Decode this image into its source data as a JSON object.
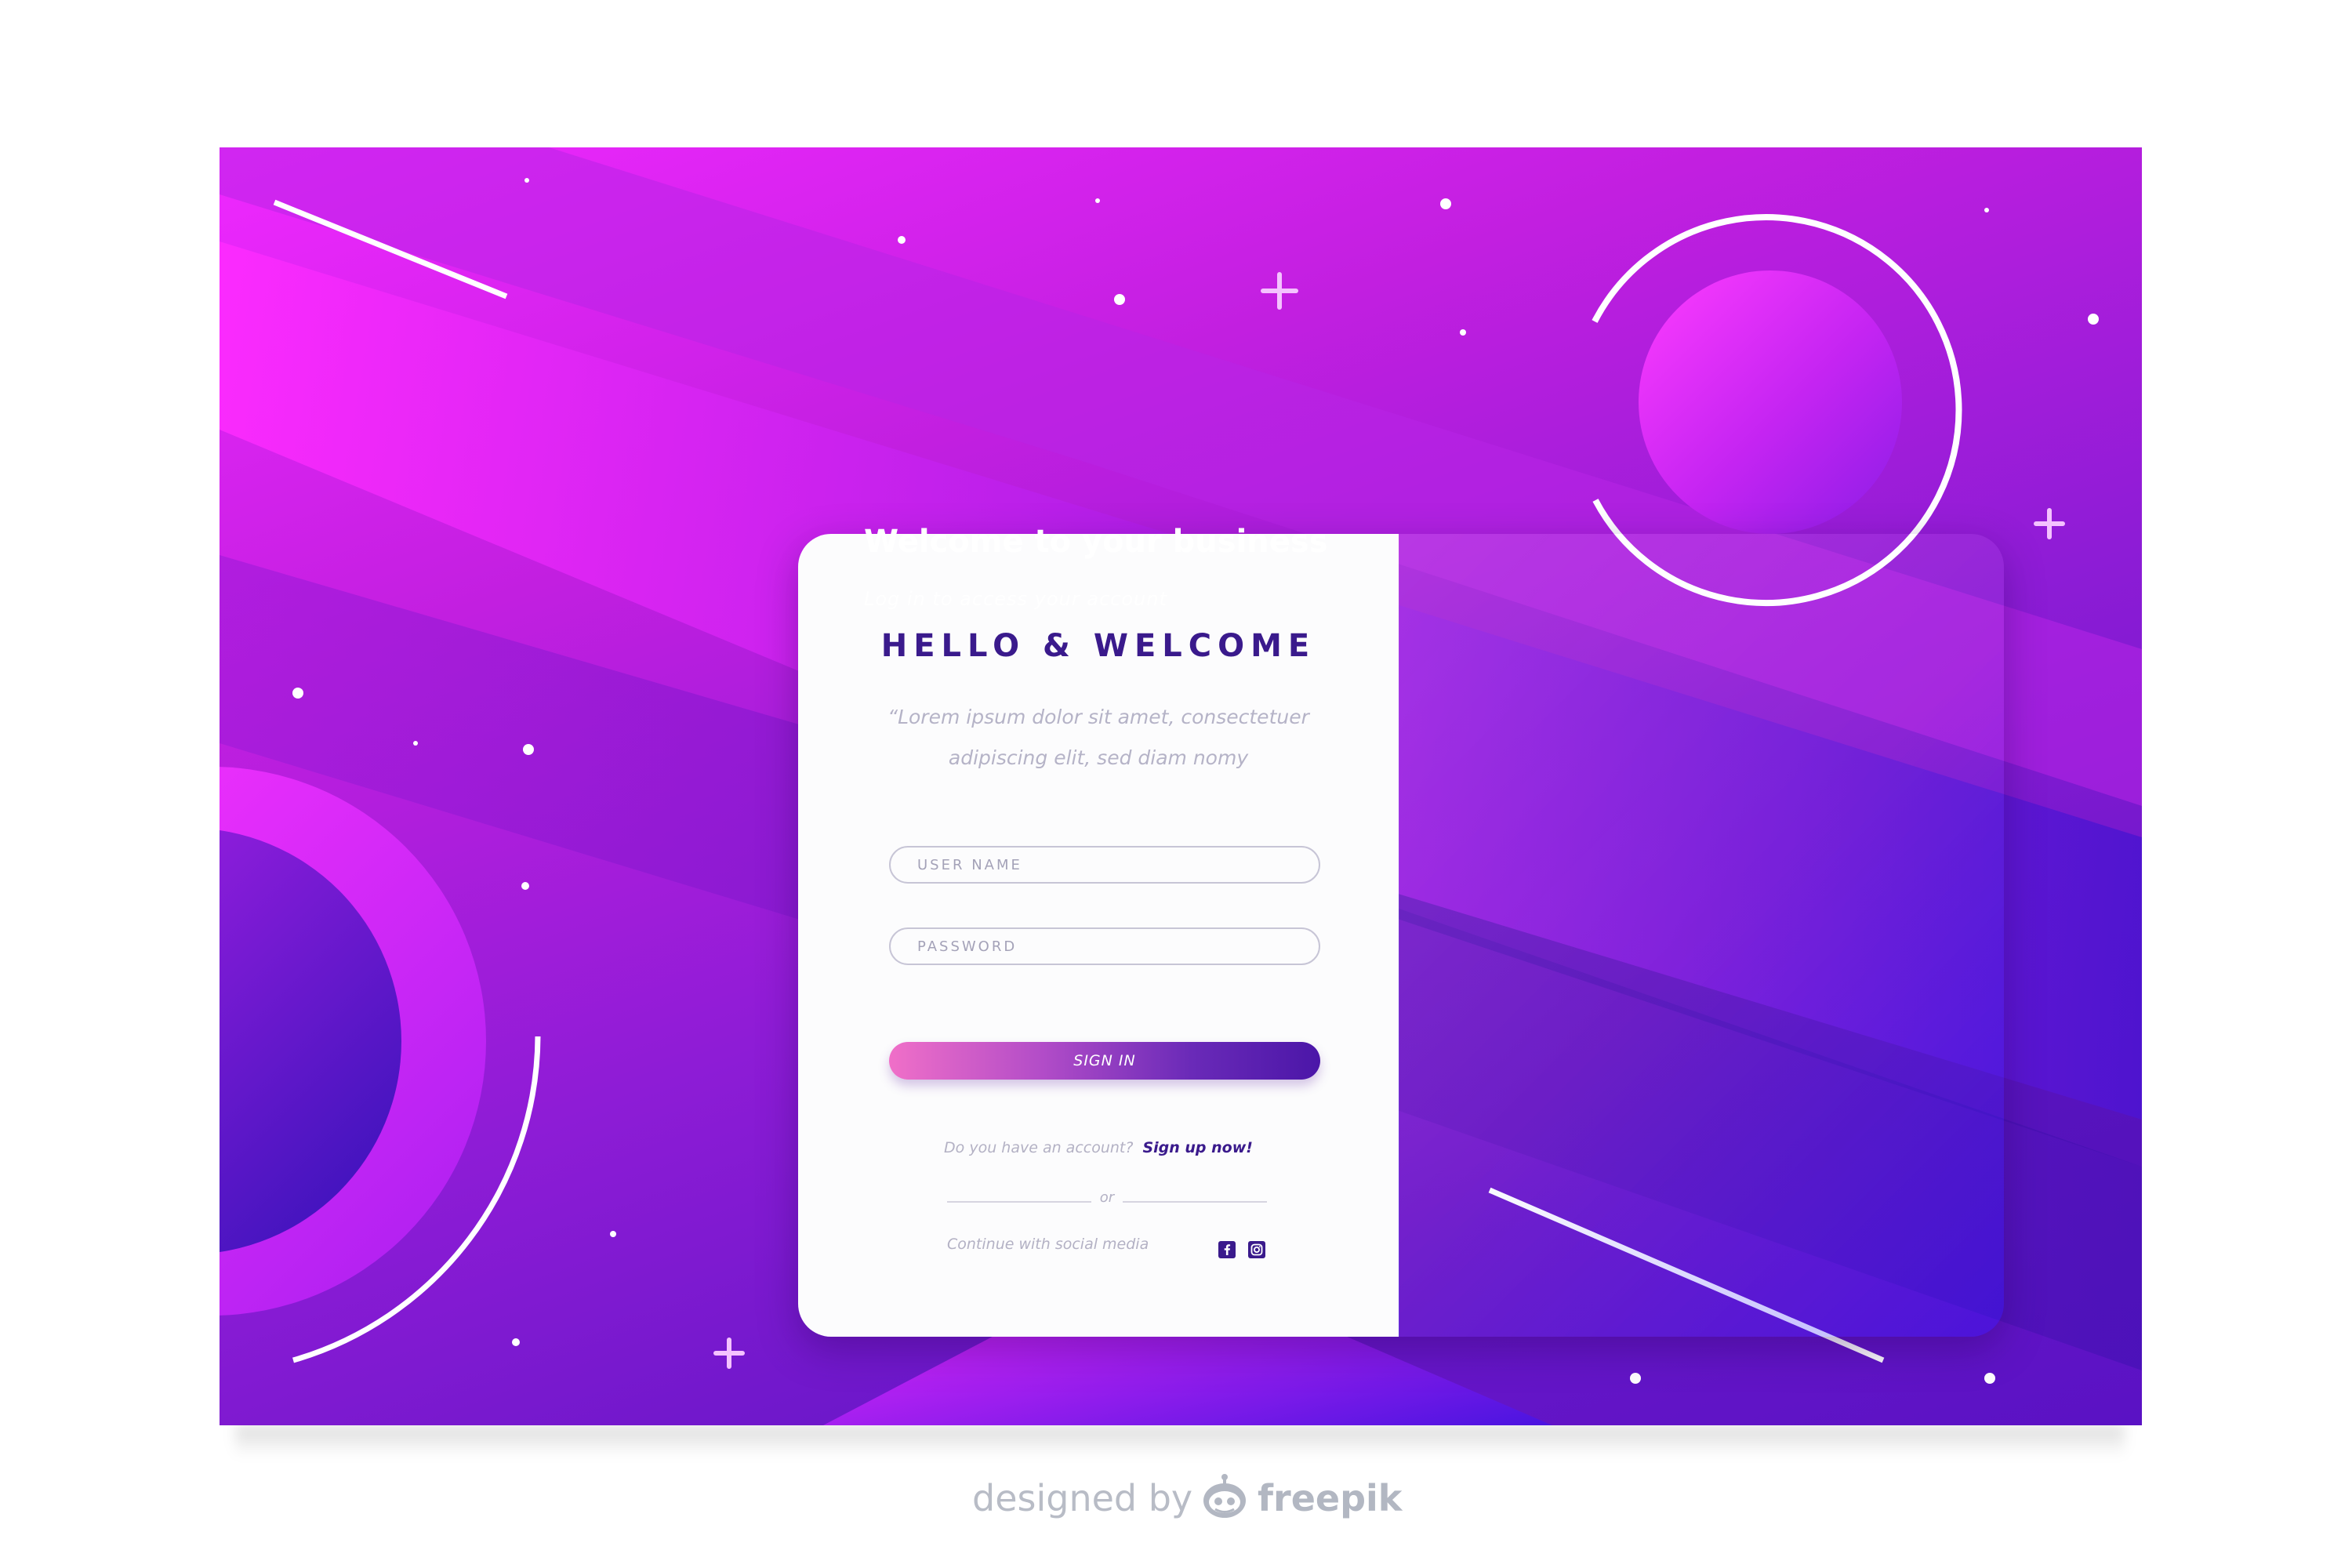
{
  "login": {
    "heading": "HELLO & WELCOME",
    "intro": "“Lorem ipsum dolor sit amet, consectetuer adipiscing elit, sed diam nomy",
    "username_placeholder": "USER NAME",
    "password_placeholder": "PASSWORD",
    "signin_label": "SIGN IN",
    "account_question": "Do you have an account?",
    "signup_label": "Sign up now!",
    "or_text": "or",
    "social_label": "Continue with  social media",
    "social_icons": [
      "facebook-icon",
      "instagram-icon"
    ]
  },
  "panel": {
    "title": "Welcome to your business",
    "subtitle": "Log in to access your account"
  },
  "credit": {
    "text": "designed by",
    "brand": "freepik"
  },
  "colors": {
    "accent": "#3a1a8c",
    "background_start": "#f028ff",
    "background_end": "#5a12c4",
    "button_start": "#f06fc8",
    "button_end": "#4b16a8"
  }
}
